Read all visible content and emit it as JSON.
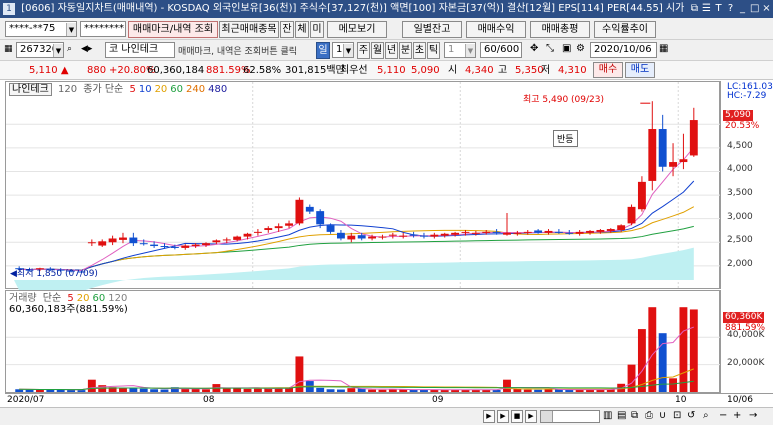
{
  "titlebar": {
    "window_id": "1",
    "title": "[0606] 자동일지차트(매매내역) - KOSDAQ 외국인보유[36(천)] 주식수[37,127(천)] 액면[100] 자본금[37(억)] 결산[12월] EPS[114] PER[44.55] 시가",
    "icons": [
      "restore-icon",
      "menu-icon",
      "text-size-icon",
      "help-icon",
      "minimize-icon",
      "maximize-icon",
      "close-icon"
    ]
  },
  "toolbar1": {
    "account": "****-**75",
    "password": "********",
    "trade_view_label": "매매마크/내역 조회",
    "recent_stocks_label": "최근매매종목",
    "balance_label": "잔",
    "exec_label": "체",
    "pending_label": "미",
    "memo_label": "메모보기",
    "daily_balance_label": "일별잔고",
    "trade_profit_label": "매매수익",
    "trade_total_label": "매매총평",
    "return_trend_label": "수익률추이"
  },
  "toolbar2": {
    "stock_code": "267320",
    "stock_name_prefix": "코",
    "stock_name": "나인테크",
    "notice": "매매마크, 내역은 조회버튼 클릭",
    "period_day": "일",
    "period_value": "1",
    "period_week": "주",
    "period_month": "월",
    "period_year": "년",
    "period_minute": "분",
    "period_second": "초",
    "period_tick": "틱",
    "tick_count": "1",
    "view_count": "60",
    "view_total": "/600",
    "date": "2020/10/06"
  },
  "quote": {
    "price": "5,110",
    "change": "880",
    "change_pct": "+20.80%",
    "volume": "60,360,184",
    "volume_pct": "881.59%",
    "turnover": "62.58%",
    "amount": "301,815백만",
    "bid_label": "최우선",
    "ask_price": "5,110",
    "bid_price": "5,090",
    "open_label": "시",
    "open": "4,340",
    "high_label": "고",
    "high": "5,350",
    "low_label": "저",
    "low": "4,310",
    "buy_label": "매수",
    "sell_label": "매도"
  },
  "price_chart": {
    "legend_name": "나인테크",
    "legend_period": "120",
    "legend_ma_label": "종가 단순",
    "legend_ma": [
      {
        "value": "5",
        "color": "#e01010"
      },
      {
        "value": "10",
        "color": "#1040d0"
      },
      {
        "value": "20",
        "color": "#e0a000"
      },
      {
        "value": "60",
        "color": "#20a040"
      },
      {
        "value": "240",
        "color": "#e07000"
      },
      {
        "value": "480",
        "color": "#2020a0"
      }
    ],
    "max_label": "최고 5,490 (09/23)",
    "min_label": "최저 1,850 (07/09)",
    "annotation": "반등",
    "lc_label": "LC:161.03",
    "hc_label": "HC:-7.29",
    "last_price_tag": "5,090",
    "last_pct_tag": "20.53%",
    "y_ticks": [
      "4,500",
      "4,000",
      "3,500",
      "3,000",
      "2,500",
      "2,000"
    ]
  },
  "volume_chart": {
    "legend_name": "거래량",
    "legend_ma_label": "단순",
    "legend_ma": [
      {
        "value": "5",
        "color": "#e01010"
      },
      {
        "value": "20",
        "color": "#e0a000"
      },
      {
        "value": "60",
        "color": "#20a040"
      },
      {
        "value": "120",
        "color": "#808080"
      }
    ],
    "volume_text": "60,360,183주(881.59%)",
    "last_volume_tag": "60,360K",
    "last_pct_tag": "881.59%",
    "y_ticks": [
      "40,000K",
      "20,000K"
    ]
  },
  "x_axis": {
    "labels": [
      "2020/07",
      "08",
      "09",
      "10",
      "10/06"
    ]
  },
  "chart_data": {
    "type": "candlestick",
    "x": [
      "2020-07-01",
      "2020-07-02",
      "2020-07-03",
      "2020-07-06",
      "2020-07-07",
      "2020-07-08",
      "2020-07-09",
      "2020-07-10",
      "2020-07-13",
      "2020-07-14",
      "2020-07-15",
      "2020-07-16",
      "2020-07-17",
      "2020-07-20",
      "2020-07-21",
      "2020-07-22",
      "2020-07-23",
      "2020-07-24",
      "2020-07-27",
      "2020-07-28",
      "2020-07-29",
      "2020-07-30",
      "2020-07-31",
      "2020-08-03",
      "2020-08-04",
      "2020-08-05",
      "2020-08-06",
      "2020-08-07",
      "2020-08-10",
      "2020-08-11",
      "2020-08-12",
      "2020-08-13",
      "2020-08-14",
      "2020-08-18",
      "2020-08-19",
      "2020-08-20",
      "2020-08-21",
      "2020-08-24",
      "2020-08-25",
      "2020-08-26",
      "2020-08-27",
      "2020-08-28",
      "2020-08-31",
      "2020-09-01",
      "2020-09-02",
      "2020-09-03",
      "2020-09-04",
      "2020-09-07",
      "2020-09-08",
      "2020-09-09",
      "2020-09-10",
      "2020-09-11",
      "2020-09-14",
      "2020-09-15",
      "2020-09-16",
      "2020-09-17",
      "2020-09-18",
      "2020-09-21",
      "2020-09-22",
      "2020-09-23",
      "2020-09-24",
      "2020-09-25",
      "2020-09-28",
      "2020-09-29",
      "2020-10-05",
      "2020-10-06"
    ],
    "open": [
      1950,
      1920,
      1930,
      1940,
      1920,
      1900,
      1880,
      2480,
      2430,
      2500,
      2550,
      2600,
      2480,
      2450,
      2420,
      2400,
      2380,
      2420,
      2440,
      2500,
      2540,
      2550,
      2620,
      2700,
      2760,
      2800,
      2850,
      2900,
      3250,
      3160,
      2860,
      2700,
      2560,
      2650,
      2580,
      2600,
      2640,
      2620,
      2660,
      2640,
      2620,
      2640,
      2660,
      2700,
      2680,
      2700,
      2720,
      2660,
      2680,
      2700,
      2750,
      2700,
      2720,
      2700,
      2680,
      2700,
      2720,
      2740,
      2760,
      2900,
      3200,
      3800,
      4900,
      4100,
      4200,
      4340
    ],
    "high": [
      1990,
      1960,
      1960,
      1970,
      1950,
      1930,
      1900,
      2560,
      2560,
      2640,
      2700,
      2700,
      2560,
      2520,
      2480,
      2450,
      2460,
      2480,
      2500,
      2560,
      2600,
      2640,
      2700,
      2780,
      2840,
      2900,
      2960,
      3450,
      3300,
      3200,
      2900,
      2760,
      2700,
      2700,
      2660,
      2660,
      2700,
      2700,
      2720,
      2700,
      2700,
      2700,
      2720,
      2760,
      2740,
      2760,
      2780,
      3120,
      2740,
      2760,
      2780,
      2780,
      2780,
      2760,
      2760,
      2760,
      2780,
      2800,
      2880,
      3300,
      3900,
      5490,
      5200,
      4600,
      4800,
      5350
    ],
    "low": [
      1900,
      1880,
      1890,
      1890,
      1870,
      1860,
      1850,
      2420,
      2400,
      2440,
      2480,
      2420,
      2430,
      2380,
      2360,
      2350,
      2340,
      2380,
      2400,
      2460,
      2480,
      2520,
      2560,
      2640,
      2700,
      2720,
      2800,
      2860,
      3100,
      2800,
      2680,
      2540,
      2500,
      2540,
      2540,
      2560,
      2580,
      2580,
      2600,
      2580,
      2580,
      2600,
      2620,
      2640,
      2640,
      2660,
      2660,
      2640,
      2640,
      2660,
      2680,
      2660,
      2680,
      2660,
      2640,
      2660,
      2680,
      2700,
      2720,
      2860,
      3150,
      3600,
      4000,
      3900,
      4050,
      4310
    ],
    "close": [
      1930,
      1910,
      1950,
      1920,
      1900,
      1880,
      1860,
      2500,
      2520,
      2580,
      2600,
      2480,
      2460,
      2420,
      2400,
      2380,
      2430,
      2450,
      2480,
      2540,
      2560,
      2620,
      2680,
      2720,
      2800,
      2840,
      2900,
      3400,
      3150,
      2880,
      2720,
      2580,
      2640,
      2580,
      2620,
      2620,
      2660,
      2640,
      2640,
      2620,
      2660,
      2680,
      2700,
      2720,
      2700,
      2720,
      2700,
      2700,
      2700,
      2720,
      2700,
      2740,
      2700,
      2680,
      2720,
      2740,
      2760,
      2780,
      2860,
      3250,
      3780,
      4900,
      4100,
      4200,
      4260,
      5090
    ],
    "volume_k": [
      2000,
      1800,
      1700,
      1900,
      1600,
      1500,
      1400,
      9000,
      5000,
      3500,
      3200,
      2800,
      2400,
      2000,
      1800,
      3500,
      2400,
      2200,
      2000,
      5800,
      2500,
      2600,
      2300,
      2400,
      2600,
      3200,
      3300,
      26000,
      8000,
      3000,
      2000,
      1800,
      2800,
      2600,
      1700,
      1600,
      1800,
      1900,
      1500,
      1700,
      1600,
      1700,
      1800,
      1600,
      1700,
      1600,
      1500,
      9000,
      2500,
      1700,
      1600,
      1800,
      1800,
      1700,
      1600,
      1800,
      2000,
      2200,
      6000,
      20000,
      46000,
      62000,
      43000,
      10000,
      62000,
      60360
    ],
    "ylim": [
      1700,
      5600
    ],
    "volume_ylim": [
      0,
      68000
    ]
  }
}
